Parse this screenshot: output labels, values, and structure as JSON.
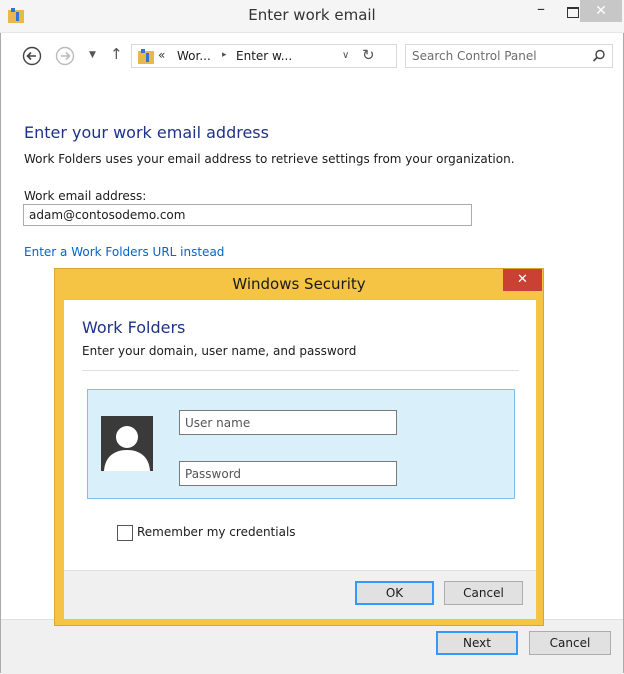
{
  "window": {
    "title": "Enter work email",
    "minimize": "–",
    "close": "✕"
  },
  "nav": {
    "address_chevron": "«",
    "segment1": "Wor...",
    "separator": "▸",
    "segment2": "Enter w...",
    "dropdown": "∨",
    "refresh": "↻",
    "search_placeholder": "Search Control Panel"
  },
  "main": {
    "heading": "Enter your work email address",
    "description": "Work Folders uses your email address to retrieve settings from your organization.",
    "email_label": "Work email address:",
    "email_value": "adam@contosodemo.com",
    "url_link": "Enter a Work Folders URL instead",
    "next_label": "Next",
    "cancel_label": "Cancel"
  },
  "security_dialog": {
    "title": "Windows Security",
    "close": "✕",
    "heading": "Work Folders",
    "subheading": "Enter your domain, user name, and password",
    "username_placeholder": "User name",
    "password_placeholder": "Password",
    "remember_label": "Remember my credentials",
    "ok_label": "OK",
    "cancel_label": "Cancel"
  },
  "colors": {
    "dialog_frame": "#f5c445",
    "close_red": "#c94132",
    "heading_blue": "#1e3287",
    "link_blue": "#0066cc",
    "tile_blue": "#d9effa"
  }
}
